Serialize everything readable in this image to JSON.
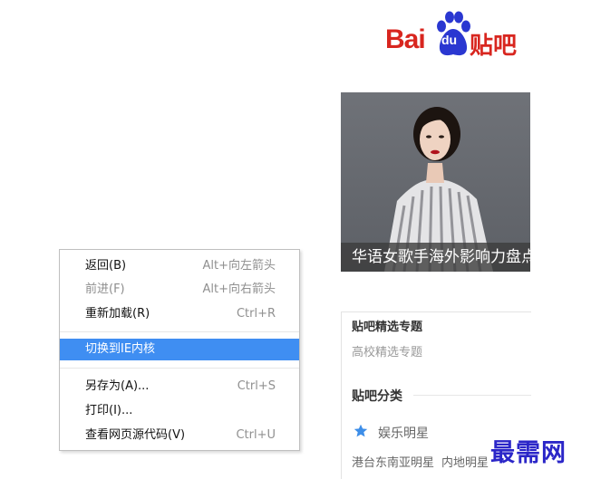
{
  "logo": {
    "bai": "Bai",
    "du": "du",
    "tieba": "贴吧"
  },
  "hero": {
    "caption": "华语女歌手海外影响力盘点"
  },
  "panel": {
    "heading": "贴吧精选专题",
    "sub": "高校精选专题",
    "category": "贴吧分类",
    "entertainment": "娱乐明星",
    "links": [
      "港台东南亚明星",
      "内地明星"
    ]
  },
  "menu": {
    "items": [
      {
        "label": "返回(B)",
        "shortcut": "Alt+向左箭头"
      },
      {
        "label": "前进(F)",
        "shortcut": "Alt+向右箭头"
      },
      {
        "label": "重新加载(R)",
        "shortcut": "Ctrl+R"
      },
      {
        "label": "切换到IE内核",
        "shortcut": ""
      },
      {
        "label": "另存为(A)...",
        "shortcut": "Ctrl+S"
      },
      {
        "label": "打印(I)...",
        "shortcut": ""
      },
      {
        "label": "查看网页源代码(V)",
        "shortcut": "Ctrl+U"
      }
    ]
  },
  "watermark": "最需网",
  "colors": {
    "brand_red": "#d8261f",
    "brand_blue": "#2a37d1",
    "menu_highlight": "#3f8ef2",
    "star": "#3d8ee8"
  }
}
